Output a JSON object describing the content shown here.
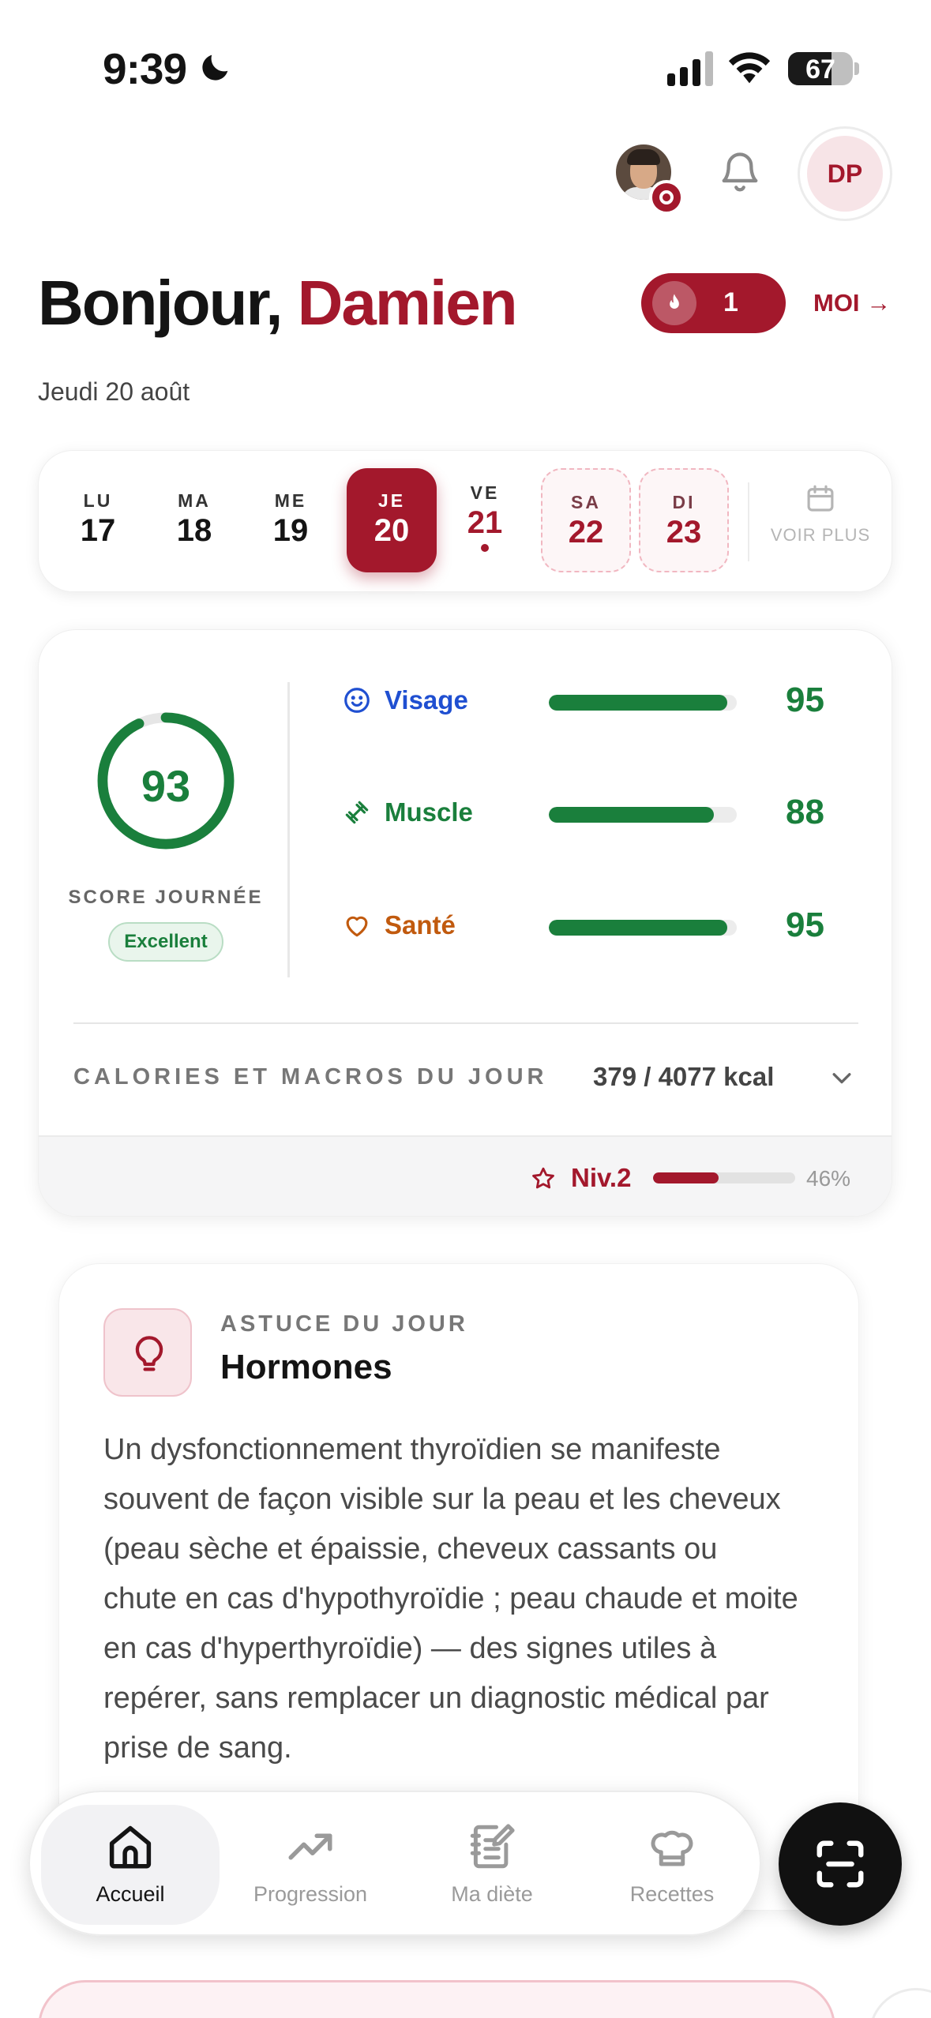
{
  "status_bar": {
    "time": "9:39",
    "battery": "67",
    "battery_level": 0.67
  },
  "header": {
    "initials": "DP"
  },
  "greeting": {
    "prefix": "Bonjour, ",
    "name": "Damien",
    "date": "Jeudi 20 août"
  },
  "streak": {
    "count": "1"
  },
  "profile_link": "MOI →",
  "week": {
    "days": [
      {
        "name": "LU",
        "num": "17",
        "state": "past"
      },
      {
        "name": "MA",
        "num": "18",
        "state": "past"
      },
      {
        "name": "ME",
        "num": "19",
        "state": "past"
      },
      {
        "name": "JE",
        "num": "20",
        "state": "selected"
      },
      {
        "name": "VE",
        "num": "21",
        "state": "today"
      },
      {
        "name": "SA",
        "num": "22",
        "state": "future"
      },
      {
        "name": "DI",
        "num": "23",
        "state": "future"
      }
    ],
    "more_label": "VOIR PLUS"
  },
  "score": {
    "value": "93",
    "fraction": 0.93,
    "label": "SCORE JOURNÉE",
    "badge": "Excellent",
    "metrics": [
      {
        "label": "Visage",
        "value": "95",
        "fraction": 0.95,
        "color": "#1f4fd1",
        "icon": "smile-icon"
      },
      {
        "label": "Muscle",
        "value": "88",
        "fraction": 0.88,
        "color": "#1a7f3c",
        "icon": "dumbbell-icon"
      },
      {
        "label": "Santé",
        "value": "95",
        "fraction": 0.95,
        "color": "#c15a0e",
        "icon": "heart-icon"
      }
    ],
    "calories_label": "CALORIES ET MACROS DU JOUR",
    "calories_value": "379 / 4077 kcal"
  },
  "level": {
    "label": "Niv.2",
    "percent": "46%",
    "fraction": 0.46
  },
  "tip": {
    "kicker": "ASTUCE DU JOUR",
    "title": "Hormones",
    "body": "Un dysfonctionnement thyroïdien se manifeste souvent de façon visible sur la peau et les cheveux (peau sèche et épaissie, cheveux cassants ou chute en cas d'hypothyroïdie ; peau chaude et moite en cas d'hyperthyroïdie) — des signes utiles à repérer, sans remplacer un diagnostic médical par prise de sang."
  },
  "nav": {
    "items": [
      {
        "label": "Accueil",
        "icon": "home-icon"
      },
      {
        "label": "Progression",
        "icon": "trend-icon"
      },
      {
        "label": "Ma diète",
        "icon": "notebook-icon"
      },
      {
        "label": "Recettes",
        "icon": "chef-hat-icon"
      }
    ]
  },
  "colors": {
    "accent": "#a3182c",
    "good": "#1a7f3c"
  }
}
